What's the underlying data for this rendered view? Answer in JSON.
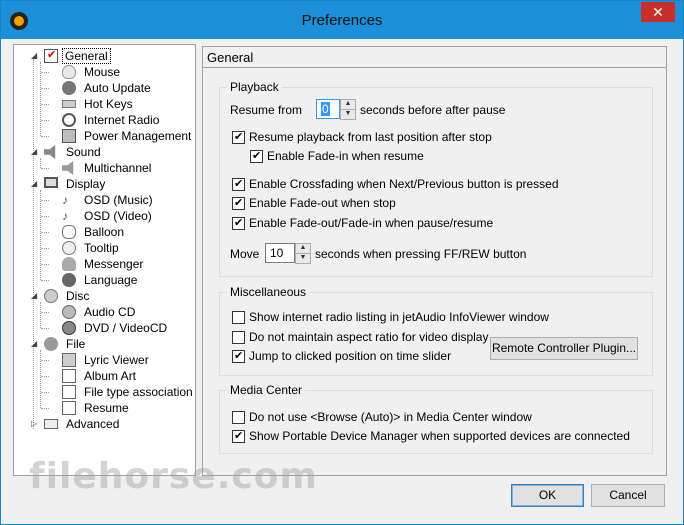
{
  "window": {
    "title": "Preferences"
  },
  "tree": [
    {
      "label": "General",
      "level": 0,
      "expanded": true,
      "selected": true,
      "icon": "checklist-icon"
    },
    {
      "label": "Mouse",
      "level": 1,
      "icon": "mouse-icon"
    },
    {
      "label": "Auto Update",
      "level": 1,
      "icon": "update-icon"
    },
    {
      "label": "Hot Keys",
      "level": 1,
      "icon": "keyboard-icon"
    },
    {
      "label": "Internet Radio",
      "level": 1,
      "icon": "radio-icon"
    },
    {
      "label": "Power Management",
      "level": 1,
      "icon": "power-icon"
    },
    {
      "label": "Sound",
      "level": 0,
      "expanded": true,
      "icon": "speaker-icon"
    },
    {
      "label": "Multichannel",
      "level": 1,
      "icon": "multichannel-icon"
    },
    {
      "label": "Display",
      "level": 0,
      "expanded": true,
      "icon": "monitor-icon"
    },
    {
      "label": "OSD (Music)",
      "level": 1,
      "icon": "osd-music-icon"
    },
    {
      "label": "OSD (Video)",
      "level": 1,
      "icon": "osd-video-icon"
    },
    {
      "label": "Balloon",
      "level": 1,
      "icon": "balloon-icon"
    },
    {
      "label": "Tooltip",
      "level": 1,
      "icon": "tooltip-icon"
    },
    {
      "label": "Messenger",
      "level": 1,
      "icon": "messenger-icon"
    },
    {
      "label": "Language",
      "level": 1,
      "icon": "globe-icon"
    },
    {
      "label": "Disc",
      "level": 0,
      "expanded": true,
      "icon": "disc-icon"
    },
    {
      "label": "Audio CD",
      "level": 1,
      "icon": "cd-icon"
    },
    {
      "label": "DVD / VideoCD",
      "level": 1,
      "icon": "dvd-icon"
    },
    {
      "label": "File",
      "level": 0,
      "expanded": true,
      "icon": "file-icon"
    },
    {
      "label": "Lyric Viewer",
      "level": 1,
      "icon": "lyric-icon"
    },
    {
      "label": "Album Art",
      "level": 1,
      "icon": "album-art-icon"
    },
    {
      "label": "File type association",
      "level": 1,
      "icon": "file-type-icon"
    },
    {
      "label": "Resume",
      "level": 1,
      "icon": "resume-icon"
    },
    {
      "label": "Advanced",
      "level": 0,
      "expanded": false,
      "icon": "advanced-icon"
    }
  ],
  "panel": {
    "title": "General",
    "playback": {
      "title": "Playback",
      "resume_from_label": "Resume from",
      "resume_from_value": "0",
      "resume_suffix": "seconds before after pause",
      "resume_playback": "Resume playback from last position after stop",
      "enable_fadein_resume": "Enable Fade-in when resume",
      "crossfading": "Enable Crossfading when Next/Previous button is pressed",
      "fadeout_stop": "Enable Fade-out when stop",
      "fade_pause": "Enable Fade-out/Fade-in when pause/resume",
      "move_label": "Move",
      "move_value": "10",
      "move_suffix": "seconds when pressing FF/REW button"
    },
    "misc": {
      "title": "Miscellaneous",
      "radio_listing": "Show internet radio listing in jetAudio InfoViewer window",
      "aspect_ratio": "Do not maintain aspect ratio for video display",
      "jump_slider": "Jump to clicked position on time slider",
      "remote_button": "Remote Controller Plugin..."
    },
    "media": {
      "title": "Media Center",
      "browse_auto": "Do not use <Browse (Auto)> in Media Center window",
      "portable_device": "Show Portable Device Manager when supported devices are connected"
    }
  },
  "buttons": {
    "ok": "OK",
    "cancel": "Cancel"
  },
  "watermark": "filehorse.com",
  "colors": {
    "titlebar": "#1c8fd8",
    "close": "#c9302c",
    "focus": "#3399ff"
  }
}
